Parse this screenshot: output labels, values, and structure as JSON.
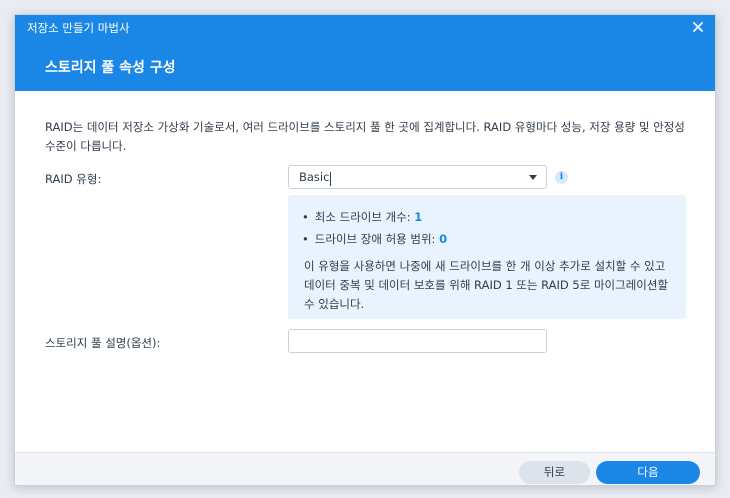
{
  "window": {
    "app_title": "저장소 만들기 마법사",
    "page_title": "스토리지 풀 속성 구성"
  },
  "content": {
    "intro": "RAID는 데이터 저장소 가상화 기술로서, 여러 드라이브를 스토리지 풀 한 곳에 집계합니다. RAID 유형마다 성능, 저장 용량 및 안정성 수준이 다릅니다.",
    "raid_type_label": "RAID 유형:",
    "raid_type_value": "Basic",
    "info": {
      "min_drives_label": "최소 드라이브 개수:",
      "min_drives_value": "1",
      "fault_tolerance_label": "드라이브 장애 허용 범위:",
      "fault_tolerance_value": "0",
      "description": "이 유형을 사용하면 나중에 새 드라이브를 한 개 이상 추가로 설치할 수 있고 데이터 중복 및 데이터 보호를 위해 RAID 1 또는 RAID 5로 마이그레이션할 수 있습니다."
    },
    "description_label": "스토리지 풀 설명(옵션):",
    "description_value": ""
  },
  "footer": {
    "back_label": "뒤로",
    "next_label": "다음"
  },
  "colors": {
    "accent": "#1a87e6",
    "panel_bg": "#e9f3fd",
    "text": "#303d4c"
  }
}
